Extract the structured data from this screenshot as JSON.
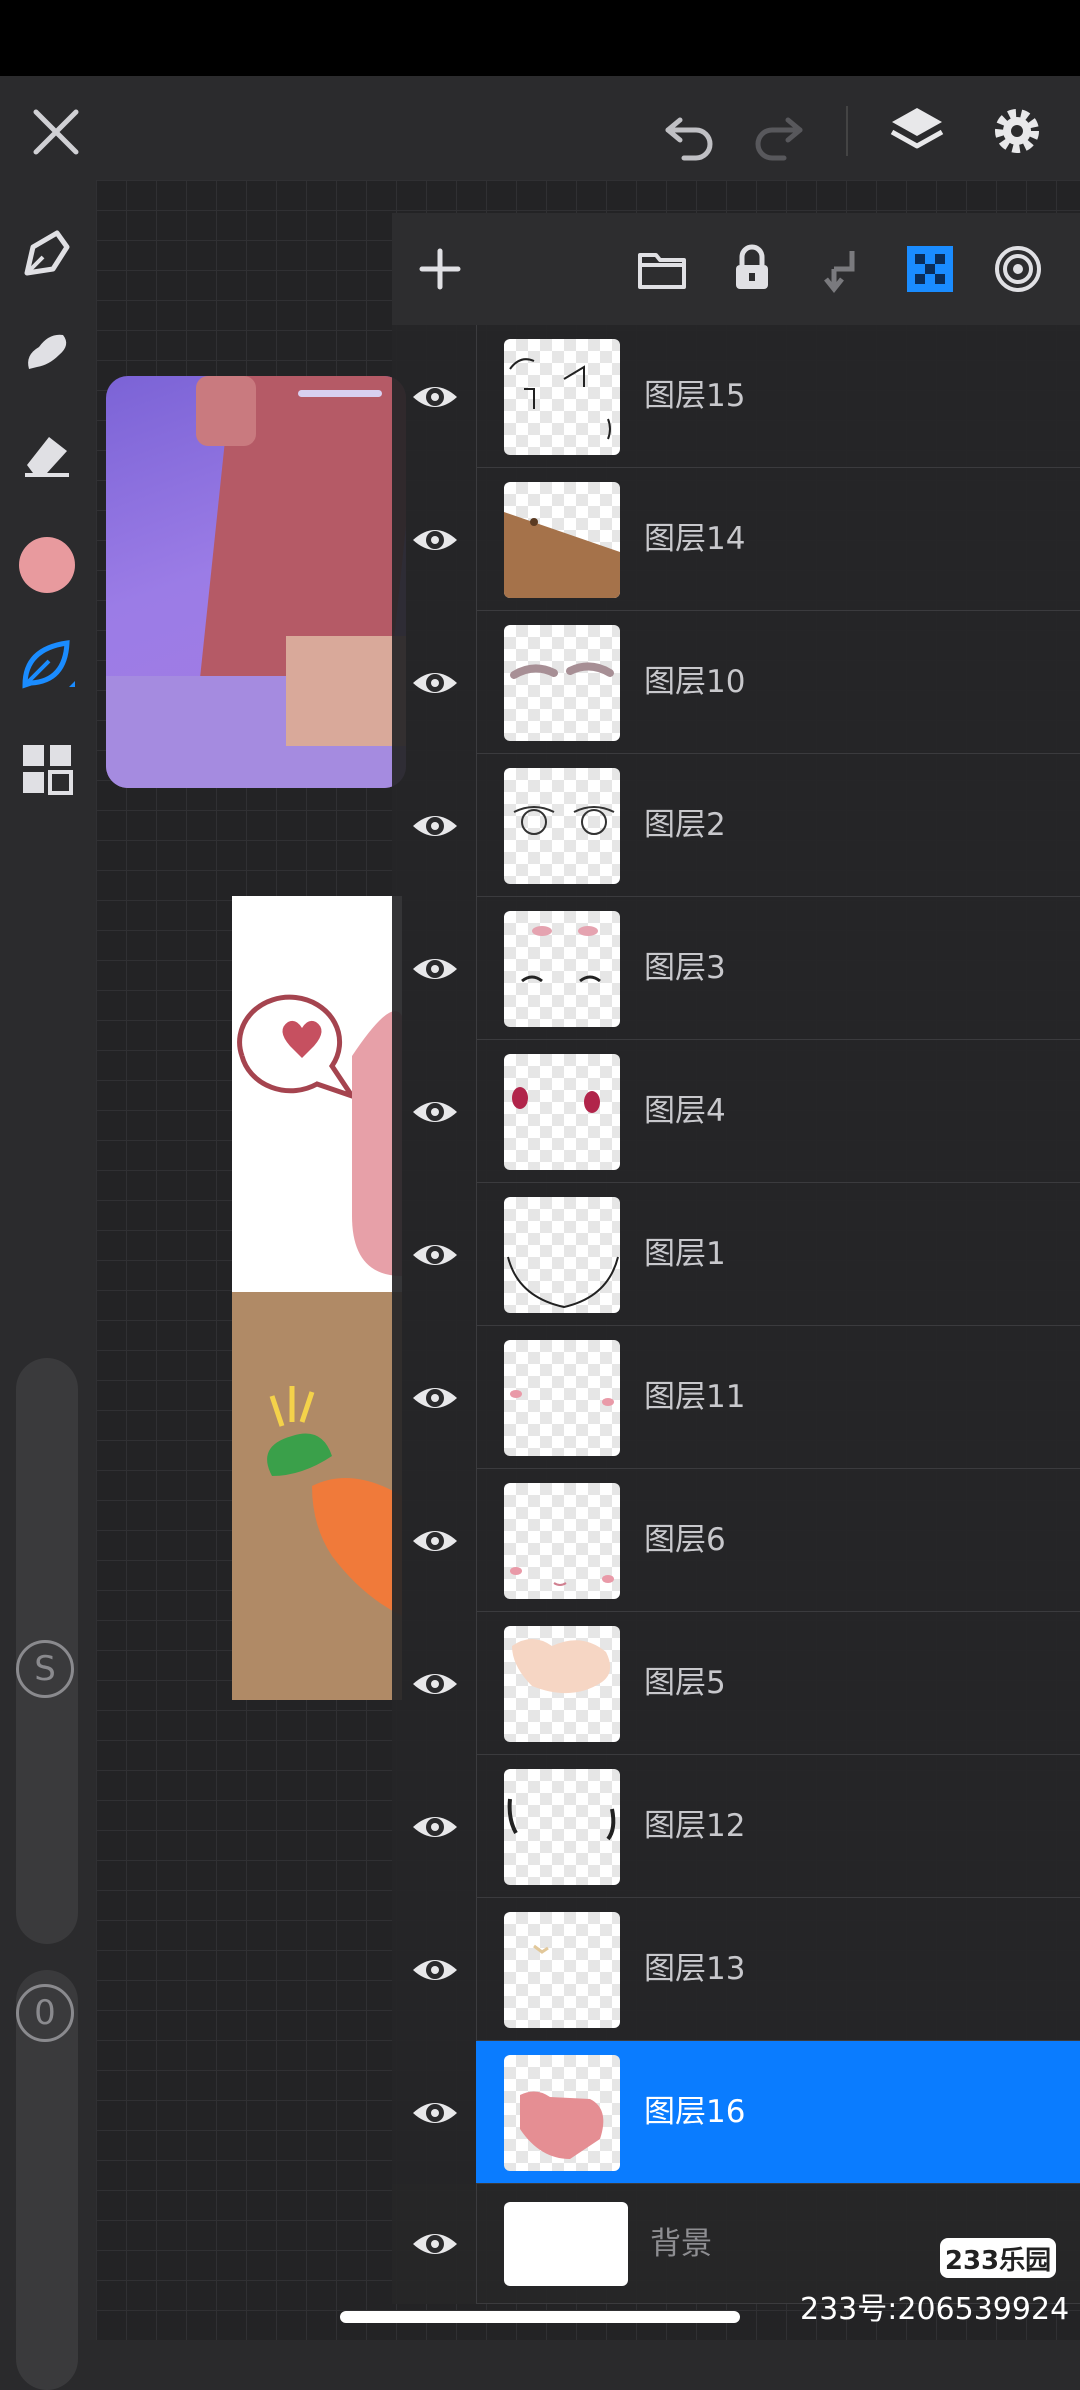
{
  "colors": {
    "accent": "#0a7cff",
    "brush_color": "#e89a9e"
  },
  "toolbar_top": {
    "close_icon": "close-icon",
    "undo_icon": "undo-icon",
    "redo_icon": "redo-icon",
    "layers_icon": "layers-icon",
    "settings_icon": "gear-icon"
  },
  "side_tools": {
    "s_label": "S",
    "o_label": "0"
  },
  "layers": {
    "header_icons": [
      "plus-icon",
      "folder-icon",
      "lock-icon",
      "merge-down-icon",
      "alpha-lock-icon",
      "target-icon"
    ],
    "items": [
      {
        "name": "图层15"
      },
      {
        "name": "图层14"
      },
      {
        "name": "图层10"
      },
      {
        "name": "图层2"
      },
      {
        "name": "图层3"
      },
      {
        "name": "图层4"
      },
      {
        "name": "图层1"
      },
      {
        "name": "图层11"
      },
      {
        "name": "图层6"
      },
      {
        "name": "图层5"
      },
      {
        "name": "图层12"
      },
      {
        "name": "图层13"
      },
      {
        "name": "图层16"
      },
      {
        "name": "背景"
      }
    ],
    "selected_index": 12
  },
  "watermark": {
    "logo": "233乐园",
    "id_text": "233号:206539924"
  }
}
